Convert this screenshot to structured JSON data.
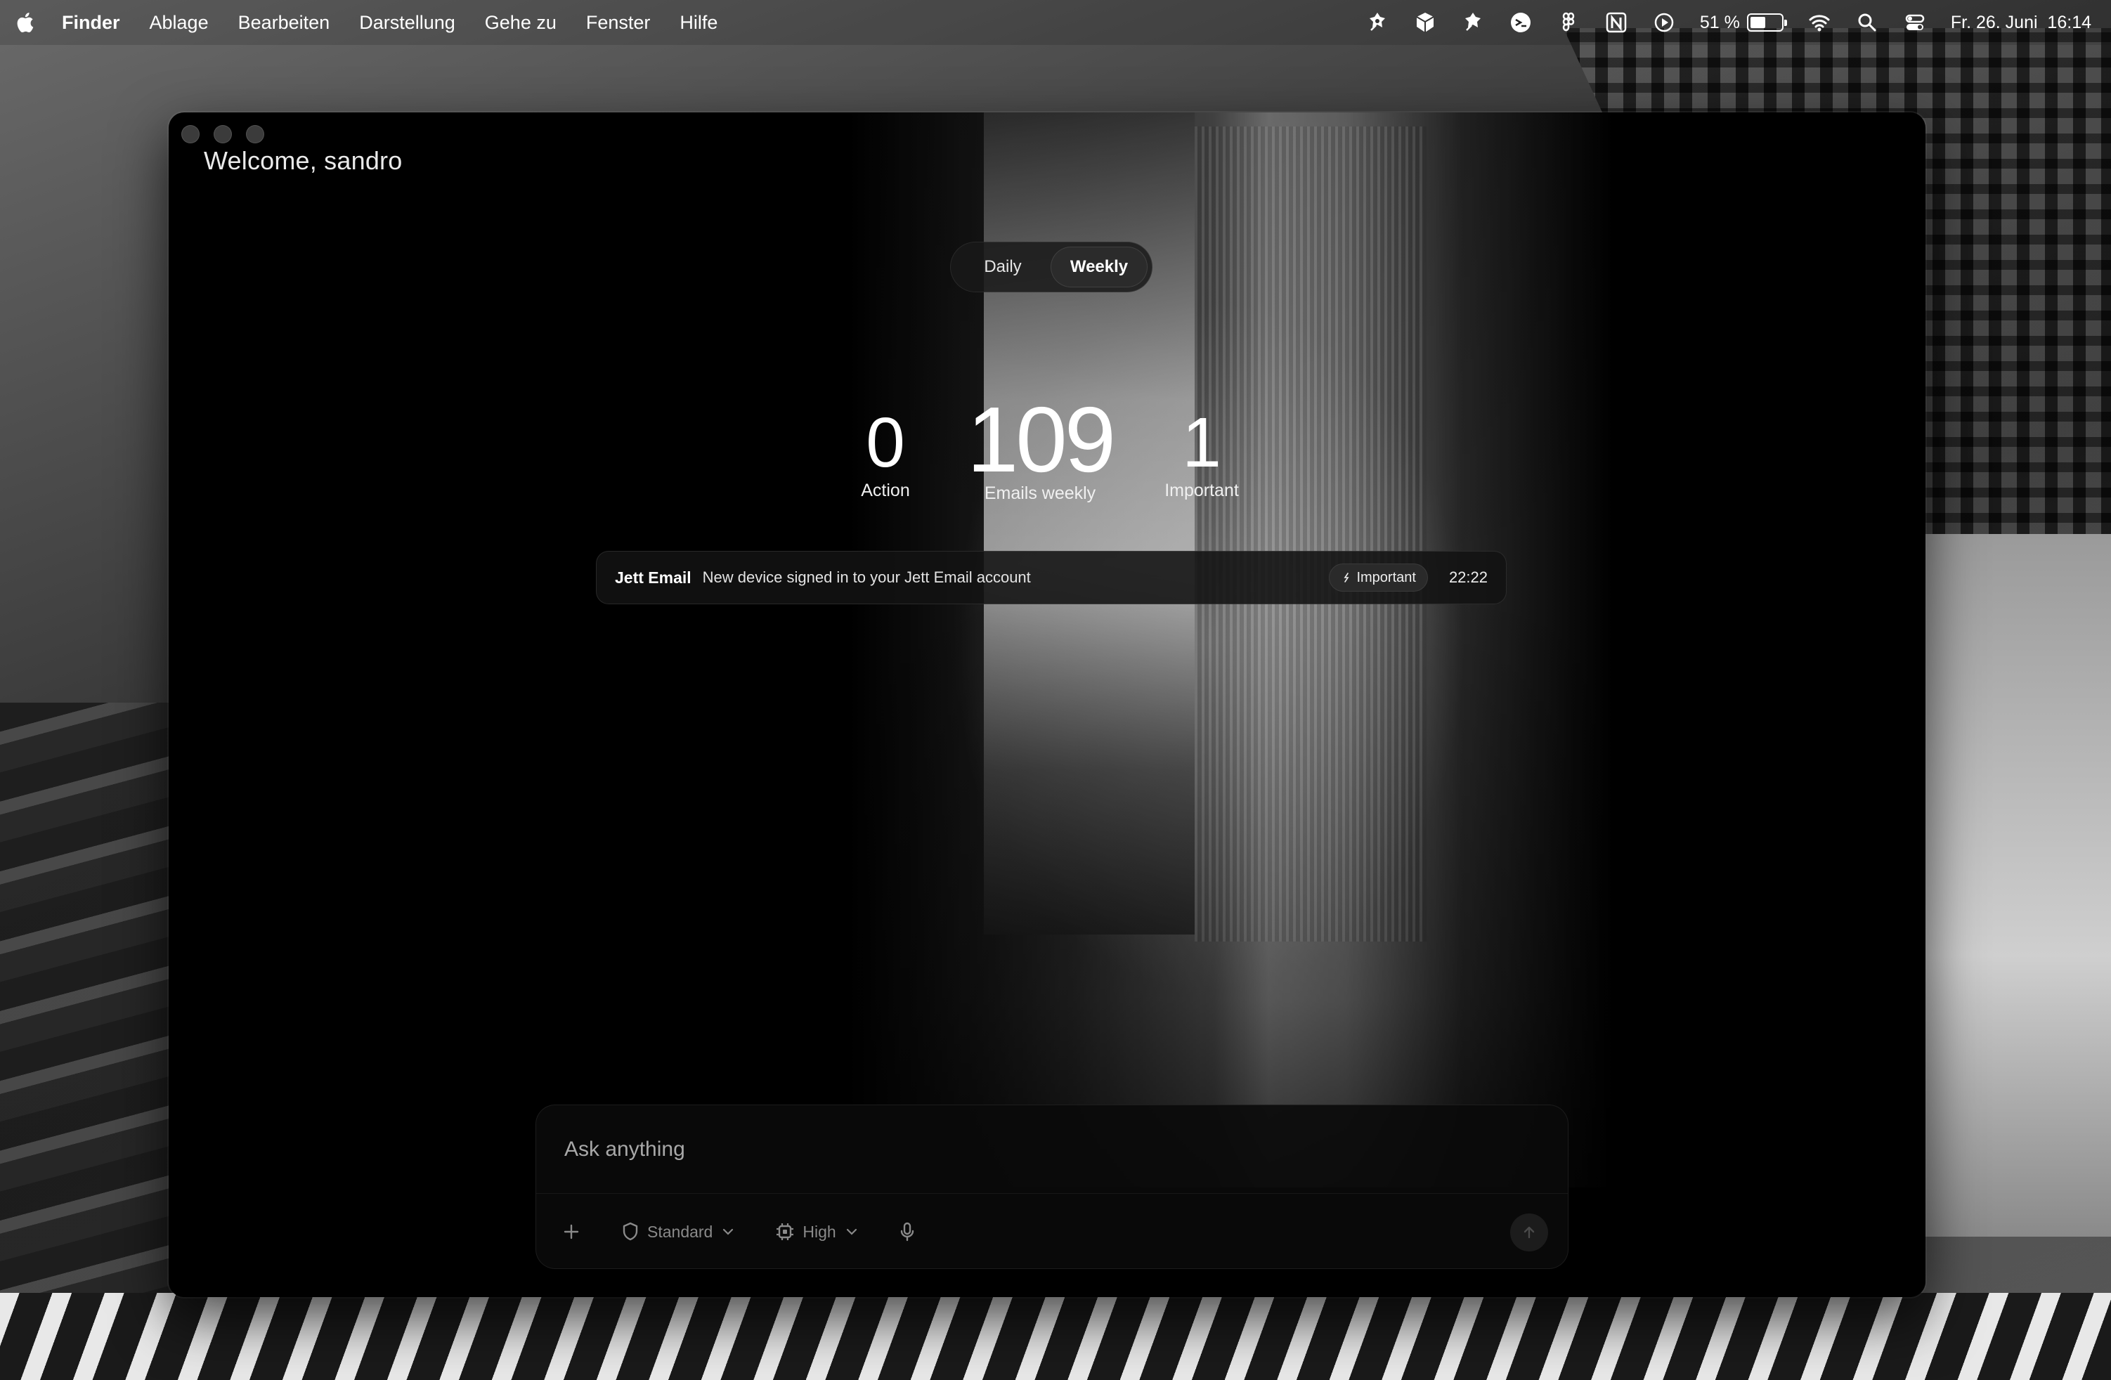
{
  "menubar": {
    "app": "Finder",
    "menus": [
      "Ablage",
      "Bearbeiten",
      "Darstellung",
      "Gehe zu",
      "Fenster",
      "Hilfe"
    ],
    "battery_percent": "51 %",
    "battery_level": 0.51,
    "datetime": "Fr. 26. Juni  16:14",
    "status_icons": [
      "pin-tool-icon",
      "cube-icon",
      "pin-tool-icon",
      "chat-icon",
      "figma-icon",
      "notion-icon",
      "play-icon",
      "battery-icon",
      "wifi-icon",
      "search-icon",
      "control-center-icon"
    ]
  },
  "window": {
    "welcome": "Welcome, sandro",
    "period_tabs": [
      {
        "label": "Daily",
        "active": false
      },
      {
        "label": "Weekly",
        "active": true
      }
    ],
    "stats": {
      "action": {
        "value": "0",
        "label": "Action"
      },
      "weekly": {
        "value": "109",
        "label": "Emails weekly"
      },
      "important": {
        "value": "1",
        "label": "Important"
      }
    },
    "notification": {
      "sender": "Jett Email",
      "subject": "New device signed in to your Jett Email account",
      "badge": "Important",
      "time": "22:22"
    },
    "composer": {
      "placeholder": "Ask anything",
      "mode": "Standard",
      "effort": "High"
    }
  },
  "colors": {
    "accent": "#ffffff",
    "window_bg": "#000000",
    "muted": "#8a8a8a"
  }
}
